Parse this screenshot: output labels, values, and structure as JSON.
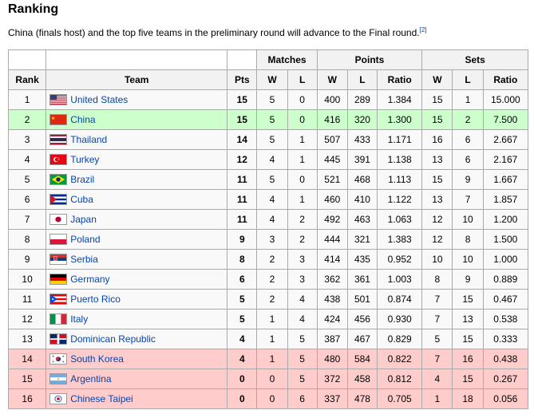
{
  "heading": "Ranking",
  "intro": "China (finals host) and the top five teams in the preliminary round will advance to the Final round.",
  "intro_ref": "[2]",
  "headers": {
    "rank": "Rank",
    "team": "Team",
    "pts": "Pts",
    "matches": "Matches",
    "points": "Points",
    "sets": "Sets",
    "w": "W",
    "l": "L",
    "ratio": "Ratio"
  },
  "rows": [
    {
      "rank": "1",
      "team": "United States",
      "flag": "usa-flag-icon",
      "pts": "15",
      "mw": "5",
      "ml": "0",
      "pw": "400",
      "pl": "289",
      "pr": "1.384",
      "sw": "15",
      "sl": "1",
      "sr": "15.000",
      "style": "plain"
    },
    {
      "rank": "2",
      "team": "China",
      "flag": "china-flag-icon",
      "pts": "15",
      "mw": "5",
      "ml": "0",
      "pw": "416",
      "pl": "320",
      "pr": "1.300",
      "sw": "15",
      "sl": "2",
      "sr": "7.500",
      "style": "green"
    },
    {
      "rank": "3",
      "team": "Thailand",
      "flag": "thailand-flag-icon",
      "pts": "14",
      "mw": "5",
      "ml": "1",
      "pw": "507",
      "pl": "433",
      "pr": "1.171",
      "sw": "16",
      "sl": "6",
      "sr": "2.667",
      "style": "plain"
    },
    {
      "rank": "4",
      "team": "Turkey",
      "flag": "turkey-flag-icon",
      "pts": "12",
      "mw": "4",
      "ml": "1",
      "pw": "445",
      "pl": "391",
      "pr": "1.138",
      "sw": "13",
      "sl": "6",
      "sr": "2.167",
      "style": "plain"
    },
    {
      "rank": "5",
      "team": "Brazil",
      "flag": "brazil-flag-icon",
      "pts": "11",
      "mw": "5",
      "ml": "0",
      "pw": "521",
      "pl": "468",
      "pr": "1.113",
      "sw": "15",
      "sl": "9",
      "sr": "1.667",
      "style": "plain"
    },
    {
      "rank": "6",
      "team": "Cuba",
      "flag": "cuba-flag-icon",
      "pts": "11",
      "mw": "4",
      "ml": "1",
      "pw": "460",
      "pl": "410",
      "pr": "1.122",
      "sw": "13",
      "sl": "7",
      "sr": "1.857",
      "style": "plain"
    },
    {
      "rank": "7",
      "team": "Japan",
      "flag": "japan-flag-icon",
      "pts": "11",
      "mw": "4",
      "ml": "2",
      "pw": "492",
      "pl": "463",
      "pr": "1.063",
      "sw": "12",
      "sl": "10",
      "sr": "1.200",
      "style": "plain"
    },
    {
      "rank": "8",
      "team": "Poland",
      "flag": "poland-flag-icon",
      "pts": "9",
      "mw": "3",
      "ml": "2",
      "pw": "444",
      "pl": "321",
      "pr": "1.383",
      "sw": "12",
      "sl": "8",
      "sr": "1.500",
      "style": "plain"
    },
    {
      "rank": "9",
      "team": "Serbia",
      "flag": "serbia-flag-icon",
      "pts": "8",
      "mw": "2",
      "ml": "3",
      "pw": "414",
      "pl": "435",
      "pr": "0.952",
      "sw": "10",
      "sl": "10",
      "sr": "1.000",
      "style": "plain"
    },
    {
      "rank": "10",
      "team": "Germany",
      "flag": "germany-flag-icon",
      "pts": "6",
      "mw": "2",
      "ml": "3",
      "pw": "362",
      "pl": "361",
      "pr": "1.003",
      "sw": "8",
      "sl": "9",
      "sr": "0.889",
      "style": "plain"
    },
    {
      "rank": "11",
      "team": "Puerto Rico",
      "flag": "puerto-rico-flag-icon",
      "pts": "5",
      "mw": "2",
      "ml": "4",
      "pw": "438",
      "pl": "501",
      "pr": "0.874",
      "sw": "7",
      "sl": "15",
      "sr": "0.467",
      "style": "plain"
    },
    {
      "rank": "12",
      "team": "Italy",
      "flag": "italy-flag-icon",
      "pts": "5",
      "mw": "1",
      "ml": "4",
      "pw": "424",
      "pl": "456",
      "pr": "0.930",
      "sw": "7",
      "sl": "13",
      "sr": "0.538",
      "style": "plain"
    },
    {
      "rank": "13",
      "team": "Dominican Republic",
      "flag": "dominican-republic-flag-icon",
      "pts": "4",
      "mw": "1",
      "ml": "5",
      "pw": "387",
      "pl": "467",
      "pr": "0.829",
      "sw": "5",
      "sl": "15",
      "sr": "0.333",
      "style": "plain"
    },
    {
      "rank": "14",
      "team": "South Korea",
      "flag": "south-korea-flag-icon",
      "pts": "4",
      "mw": "1",
      "ml": "5",
      "pw": "480",
      "pl": "584",
      "pr": "0.822",
      "sw": "7",
      "sl": "16",
      "sr": "0.438",
      "style": "red"
    },
    {
      "rank": "15",
      "team": "Argentina",
      "flag": "argentina-flag-icon",
      "pts": "0",
      "mw": "0",
      "ml": "5",
      "pw": "372",
      "pl": "458",
      "pr": "0.812",
      "sw": "4",
      "sl": "15",
      "sr": "0.267",
      "style": "red"
    },
    {
      "rank": "16",
      "team": "Chinese Taipei",
      "flag": "chinese-taipei-flag-icon",
      "pts": "0",
      "mw": "0",
      "ml": "6",
      "pw": "337",
      "pl": "478",
      "pr": "0.705",
      "sw": "1",
      "sl": "18",
      "sr": "0.056",
      "style": "red"
    }
  ],
  "colors": {
    "advance_row": "#ccffcc",
    "eliminated_row": "#ffcccc",
    "link": "#0645ad",
    "header_bg": "#f2f2f2"
  }
}
